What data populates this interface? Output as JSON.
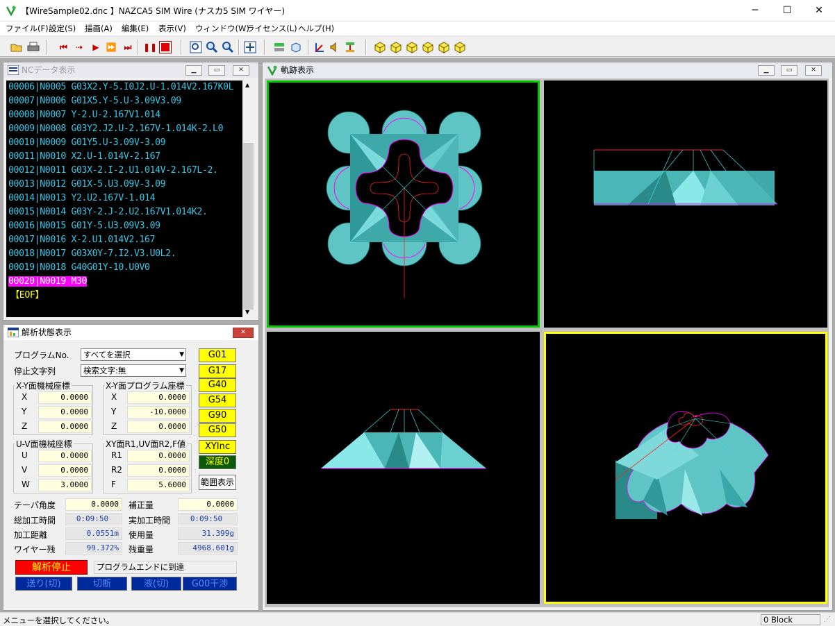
{
  "window": {
    "title": "【WireSample02.dnc 】NAZCA5 SIM Wire (ナスカ5 SIM ワイヤー)",
    "minimize": "─",
    "maximize": "☐",
    "close": "✕"
  },
  "menu": [
    "ファイル(F)",
    "設定(S)",
    "描画(A)",
    "編集(E)",
    "表示(V)",
    "ウィンドウ(W)",
    "ライセンス(L)",
    "ヘルプ(H)"
  ],
  "nc_window": {
    "title": "NCデータ表示",
    "lines": [
      "00006|N0005 G03X2.Y-5.I0J2.U-1.014V2.167K0L",
      "00007|N0006 G01X5.Y-5.U-3.09V3.09",
      "00008|N0007 Y-2.U-2.167V1.014",
      "00009|N0008 G03Y2.J2.U-2.167V-1.014K-2.L0",
      "00010|N0009 G01Y5.U-3.09V-3.09",
      "00011|N0010 X2.U-1.014V-2.167",
      "00012|N0011 G03X-2.I-2.U1.014V-2.167L-2.",
      "00013|N0012 G01X-5.U3.09V-3.09",
      "00014|N0013 Y2.U2.167V-1.014",
      "00015|N0014 G03Y-2.J-2.U2.167V1.014K2.",
      "00016|N0015 G01Y-5.U3.09V3.09",
      "00017|N0016 X-2.U1.014V2.167",
      "00018|N0017 G03X0Y-7.I2.V3.U0L2.",
      "00019|N0018 G40G01Y-10.U0V0",
      "00020|N0019 M30",
      "【EOF】"
    ]
  },
  "analysis": {
    "title": "解析状態表示",
    "program_label": "プログラムNo.",
    "program_value": "すべてを選択",
    "stop_label": "停止文字列",
    "stop_value": "検索文字:無",
    "xy_machine": {
      "title": "X-Y面機械座標",
      "x": "0.0000",
      "y": "0.0000",
      "z": "0.0000"
    },
    "xy_program": {
      "title": "X-Y面プログラム座標",
      "x": "0.0000",
      "y": "-10.0000",
      "z": "0.0000"
    },
    "uv_machine": {
      "title": "U-V面機械座標",
      "u": "0.0000",
      "v": "0.0000",
      "w": "3.0000"
    },
    "r_values": {
      "title": "XY面R1,UV面R2,F値",
      "r1": "0.0000",
      "r2": "0.0000",
      "f": "5.6000"
    },
    "axis_labels": {
      "x": "X",
      "y": "Y",
      "z": "Z",
      "u": "U",
      "v": "V",
      "w": "W",
      "r1": "R1",
      "r2": "R2",
      "f": "F"
    },
    "gcodes": [
      "G01",
      "G17",
      "G40",
      "G54",
      "G90",
      "G50",
      "XYInc"
    ],
    "depth": "深度0",
    "range_button": "範囲表示",
    "taper_label": "テーパ角度",
    "taper_value": "0.0000",
    "comp_label": "補正量",
    "comp_value": "0.0000",
    "total_time_label": "総加工時間",
    "total_time_value": "0:09:50",
    "actual_time_label": "実加工時間",
    "actual_time_value": "0:09:50",
    "distance_label": "加工距離",
    "distance_value": "0.0551m",
    "usage_label": "使用量",
    "usage_value": "31.399g",
    "wire_left_label": "ワイヤー残",
    "wire_left_value": "99.372%",
    "remain_weight_label": "残重量",
    "remain_weight_value": "4968.601g",
    "stop_button": "解析停止",
    "message": "プログラムエンドに到達",
    "btn_feed": "送り(切)",
    "btn_cut": "切断",
    "btn_liquid": "液(切)",
    "btn_g00": "G00干渉"
  },
  "trajectory": {
    "title": "軌跡表示"
  },
  "status": {
    "left": "メニューを選択してください。",
    "right": "0 Block"
  },
  "colors": {
    "accent_green": "#00c800",
    "accent_yellow": "#ffff00",
    "model": "#49b7b7",
    "path_red": "#ff0000",
    "nc_text": "#35c8e8",
    "nc_select": "#ff00ff"
  }
}
